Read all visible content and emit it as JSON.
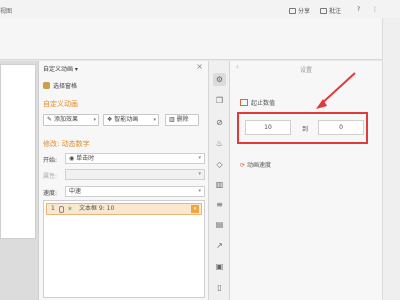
{
  "topbar": {
    "crumb": "视图",
    "share": "分享",
    "comment": "批注",
    "help": "?",
    "more": "⋮"
  },
  "anim_panel": {
    "title": "自定义动画 ▾",
    "close": "×",
    "selection_pane": "选择窗格",
    "section_custom": "自定义动画",
    "add_effect": "添加效果",
    "smart_anim": "智能动画",
    "delete": "删除",
    "section_modify": "修改: 动态数字",
    "start_label": "开始:",
    "start_value": "单击时",
    "prop_label": "属性:",
    "prop_value": "",
    "speed_label": "速度:",
    "speed_value": "中速",
    "items": [
      {
        "index": "1",
        "text": "文本框 9: 10"
      }
    ]
  },
  "settings_panel": {
    "title": "设置",
    "back": "‹",
    "start_end_label": "起止数值",
    "from_value": "10",
    "to_label": "到",
    "to_value": "0",
    "speed_label": "动画速度"
  },
  "colors": {
    "accent": "#e08a24",
    "highlight": "#e03b3b"
  }
}
